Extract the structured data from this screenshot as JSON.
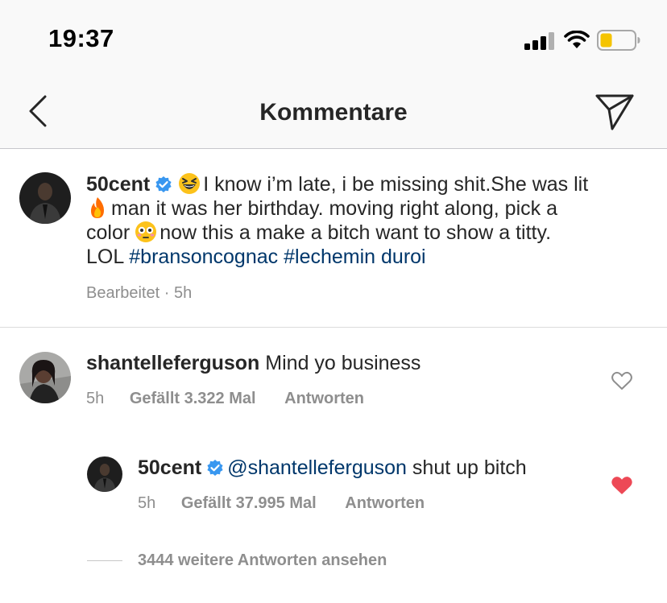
{
  "status_bar": {
    "time": "19:37"
  },
  "header": {
    "title": "Kommentare"
  },
  "caption": {
    "username": "50cent",
    "line1_text": "I know i’m late, i be missing shit.She was lit",
    "line2_text": "man it was her birthday. moving right along, pick a",
    "line3_prefix": "color",
    "line3_text": "now this a make a bitch want to show a titty.",
    "line4_text": "LOL",
    "hashtags": [
      "#bransoncognac",
      "#lechemin duroi"
    ],
    "meta": "Bearbeitet · 5h"
  },
  "comments": [
    {
      "username": "shantelleferguson",
      "text": "Mind yo business",
      "time": "5h",
      "likes": "Gefällt 3.322 Mal",
      "reply_label": "Antworten",
      "liked": false
    }
  ],
  "reply": {
    "username": "50cent",
    "mention": "@shantelleferguson",
    "text": "shut up bitch",
    "time": "5h",
    "likes": "Gefällt 37.995 Mal",
    "reply_label": "Antworten",
    "liked": true
  },
  "view_more_replies": "3444 weitere Antworten ansehen",
  "colors": {
    "link": "#00376b",
    "liked_heart": "#ed4956",
    "verified": "#3897f0",
    "muted": "#8e8e8e"
  },
  "icons": [
    "back-icon",
    "send-icon",
    "verified-icon",
    "heart-icon",
    "heart-filled-icon",
    "grinning-squint-emoji",
    "fire-emoji",
    "flushed-emoji"
  ]
}
